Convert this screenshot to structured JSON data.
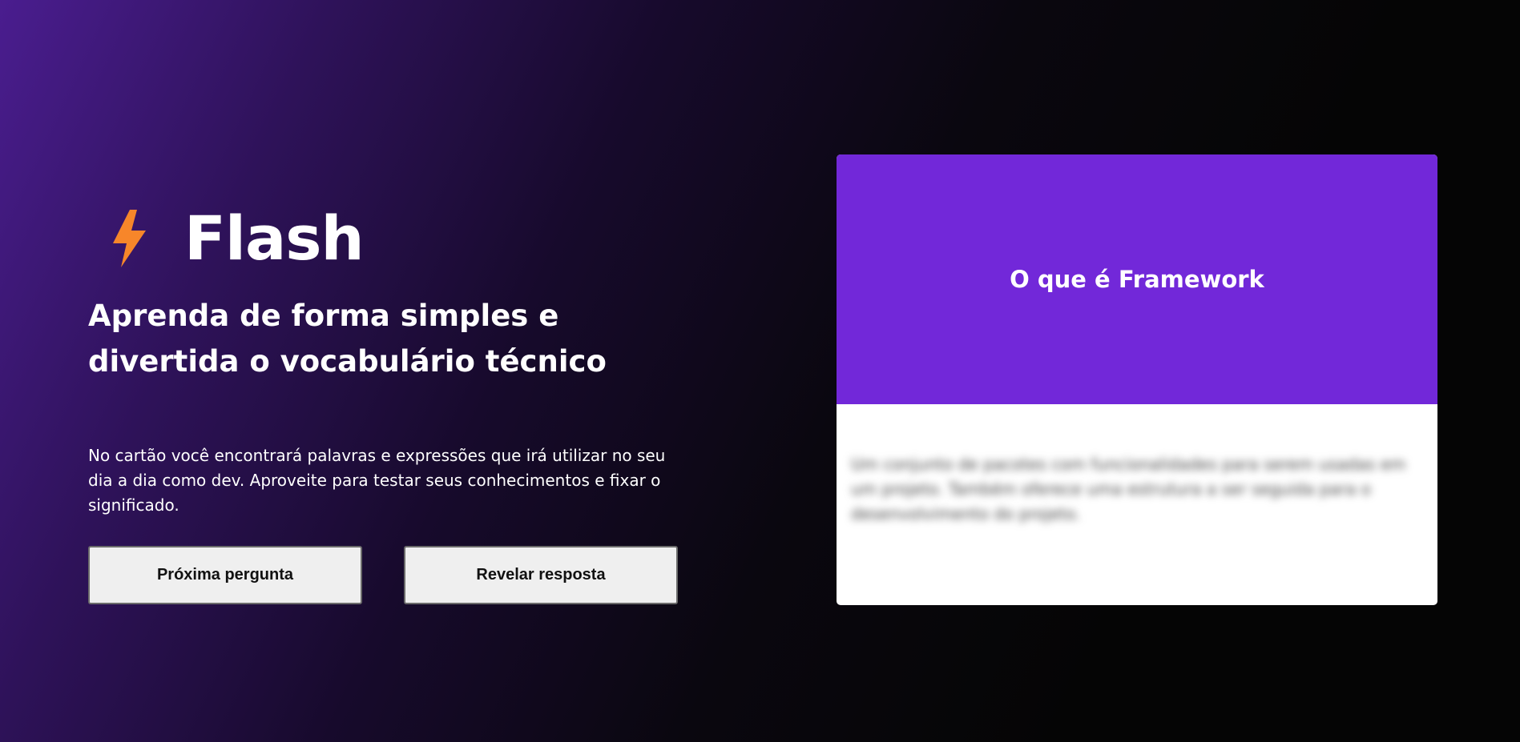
{
  "brand": {
    "name": "Flash",
    "icon": "lightning-bolt-icon",
    "icon_color": "#f7862a"
  },
  "hero": {
    "headline": "Aprenda de forma simples e divertida o vocabulário técnico",
    "description": "No cartão você encontrará palavras e expressões que irá utilizar no seu dia a dia como dev. Aproveite para testar seus conhecimentos e fixar o significado."
  },
  "actions": {
    "next_label": "Próxima pergunta",
    "reveal_label": "Revelar resposta"
  },
  "card": {
    "question": "O que é Framework",
    "answer": "Um conjunto de pacotes com funcionalidades para serem usadas em um projeto. Também oferece uma estrutura a ser seguida para o desenvolvimento do projeto.",
    "answer_hidden": true,
    "accent_color": "#7228d9"
  }
}
